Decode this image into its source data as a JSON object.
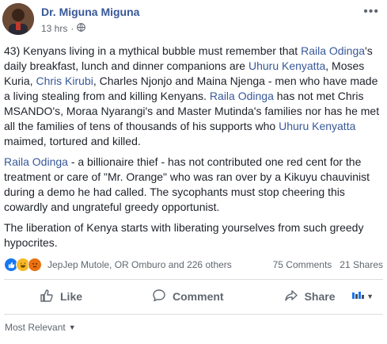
{
  "post": {
    "author": "Dr. Miguna Miguna",
    "time": "13 hrs",
    "visibility_icon": "globe-icon",
    "more_icon": "ellipsis-icon",
    "paragraphs": [
      {
        "segments": [
          {
            "text": "43) Kenyans living in a mythical bubble must remember that ",
            "link": false
          },
          {
            "text": "Raila Odinga",
            "link": true
          },
          {
            "text": "'s daily breakfast, lunch and dinner companions are ",
            "link": false
          },
          {
            "text": "Uhuru Kenyatta",
            "link": true
          },
          {
            "text": ", Moses Kuria, ",
            "link": false
          },
          {
            "text": "Chris Kirubi",
            "link": true
          },
          {
            "text": ", Charles Njonjo and Maina Njenga - men who have made a living stealing from and killing Kenyans. ",
            "link": false
          },
          {
            "text": "Raila Odinga",
            "link": true
          },
          {
            "text": " has not met Chris MSANDO's, Moraa Nyarangi's and Master Mutinda's families nor has he met all the families of tens of thousands of his supports who ",
            "link": false
          },
          {
            "text": "Uhuru Kenyatta",
            "link": true
          },
          {
            "text": " maimed, tortured and killed.",
            "link": false
          }
        ]
      },
      {
        "segments": [
          {
            "text": "Raila Odinga",
            "link": true
          },
          {
            "text": " - a billionaire thief - has not contributed one red cent for the treatment or care of \"Mr. Orange\" who was ran over by a Kikuyu chauvinist during a demo he had called. The sycophants must stop cheering this cowardly and ungrateful greedy opportunist.",
            "link": false
          }
        ]
      },
      {
        "segments": [
          {
            "text": "The liberation of Kenya starts with liberating yourselves from such greedy hypocrites.",
            "link": false
          }
        ]
      }
    ]
  },
  "reactions": {
    "icons": [
      "like-icon",
      "haha-icon",
      "angry-icon"
    ],
    "names": "JepJep Mutole, OR Omburo and 226 others",
    "comments": "75 Comments",
    "shares": "21 Shares"
  },
  "actions": {
    "like": "Like",
    "comment": "Comment",
    "share": "Share"
  },
  "comments_filter": {
    "label": "Most Relevant"
  },
  "colors": {
    "link": "#385898",
    "text": "#1d2129",
    "meta": "#606770",
    "like_blue": "#1877f2"
  }
}
